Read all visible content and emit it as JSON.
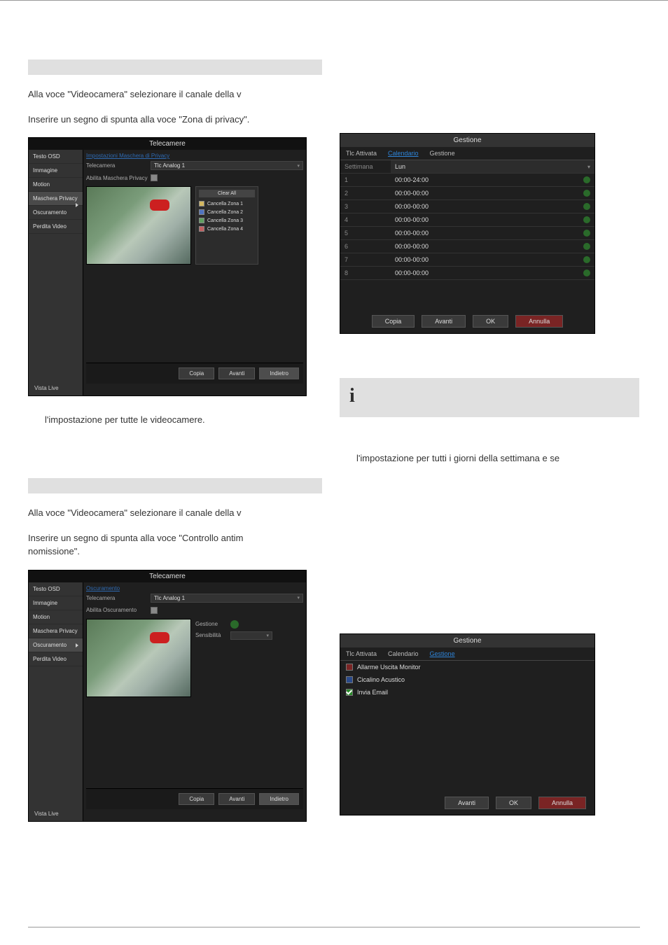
{
  "section1": {
    "line1": "Alla voce \"Videocamera\" selezionare il canale della v",
    "line2": "Inserire un segno di spunta alla voce \"Zona di privacy\"."
  },
  "app_privacy": {
    "title": "Telecamere",
    "sidebar": [
      "Testo OSD",
      "Immagine",
      "Motion",
      "Maschera Privacy",
      "Oscuramento",
      "Perdita Video"
    ],
    "crumb": "Impostazioni Maschera di Privacy",
    "camera_label": "Telecamera",
    "camera_value": "Tlc Analog 1",
    "enable_label": "Abilita Maschera Privacy",
    "zones": {
      "clear_all": "Clear All",
      "items": [
        "Cancella Zona 1",
        "Cancella Zona 2",
        "Cancella Zona 3",
        "Cancella Zona 4"
      ]
    },
    "vista": "Vista Live",
    "buttons": [
      "Copia",
      "Avanti",
      "Indietro"
    ]
  },
  "gestione_cal": {
    "title": "Gestione",
    "tabs": [
      "Tlc Attivata",
      "Calendario",
      "Gestione"
    ],
    "week_label": "Settimana",
    "week_value": "Lun",
    "rows": [
      {
        "n": "1",
        "t": "00:00-24:00"
      },
      {
        "n": "2",
        "t": "00:00-00:00"
      },
      {
        "n": "3",
        "t": "00:00-00:00"
      },
      {
        "n": "4",
        "t": "00:00-00:00"
      },
      {
        "n": "5",
        "t": "00:00-00:00"
      },
      {
        "n": "6",
        "t": "00:00-00:00"
      },
      {
        "n": "7",
        "t": "00:00-00:00"
      },
      {
        "n": "8",
        "t": "00:00-00:00"
      }
    ],
    "buttons": [
      "Copia",
      "Avanti",
      "OK",
      "Annulla"
    ]
  },
  "info_icon": "i",
  "section1_note": "l'impostazione per tutte le videocamere.",
  "section_cal_note": "l'impostazione per tutti i giorni della settimana e se",
  "section2": {
    "line1": "Alla voce \"Videocamera\" selezionare il canale della v",
    "line2a": "Inserire un segno di spunta alla voce \"Controllo antim",
    "line2b": "nomissione\"."
  },
  "app_tamper": {
    "title": "Telecamere",
    "sidebar": [
      "Testo OSD",
      "Immagine",
      "Motion",
      "Maschera Privacy",
      "Oscuramento",
      "Perdita Video"
    ],
    "crumb": "Oscuramento",
    "camera_label": "Telecamera",
    "camera_value": "Tlc Analog 1",
    "enable_label": "Abilita Oscuramento",
    "opt1_label": "Gestione",
    "opt2_label": "Sensibilità",
    "vista": "Vista Live",
    "buttons": [
      "Copia",
      "Avanti",
      "Indietro"
    ]
  },
  "gestione_act": {
    "title": "Gestione",
    "tabs": [
      "Tlc Attivata",
      "Calendario",
      "Gestione"
    ],
    "items": [
      "Allarme Uscita Monitor",
      "Cicalino Acustico",
      "Invia Email"
    ],
    "buttons": [
      "Avanti",
      "OK",
      "Annulla"
    ]
  }
}
